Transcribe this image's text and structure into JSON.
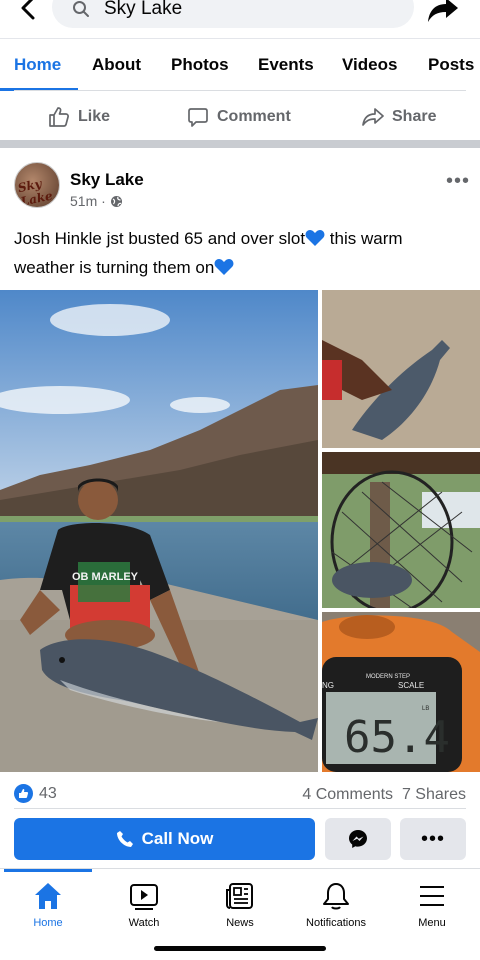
{
  "search": {
    "value": "Sky Lake"
  },
  "tabs": [
    "Home",
    "About",
    "Photos",
    "Events",
    "Videos",
    "Posts"
  ],
  "actions": {
    "like": "Like",
    "comment": "Comment",
    "share": "Share"
  },
  "post": {
    "author": "Sky Lake",
    "time": "51m · ",
    "text_line1": "Josh Hinkle jst busted 65 and over slot",
    "text_line1b": " this warm",
    "text_line2": "weather is turning them on",
    "avatar_text": "Sky Lake",
    "scale": {
      "brand": "MODERN STEP",
      "word": "SCALE",
      "side": "NG",
      "reading": "65.4",
      "unit": "LB"
    },
    "shirt_text": "OB MARLEY"
  },
  "stats": {
    "reactions": "43",
    "comments": "4 Comments",
    "shares": "7 Shares"
  },
  "buttons": {
    "call_now": "Call Now"
  },
  "nav": [
    "Home",
    "Watch",
    "News",
    "Notifications",
    "Menu"
  ],
  "colors": {
    "accent": "#1b74e4",
    "secondary_text": "#65676b",
    "button_gray": "#e4e6eb"
  }
}
